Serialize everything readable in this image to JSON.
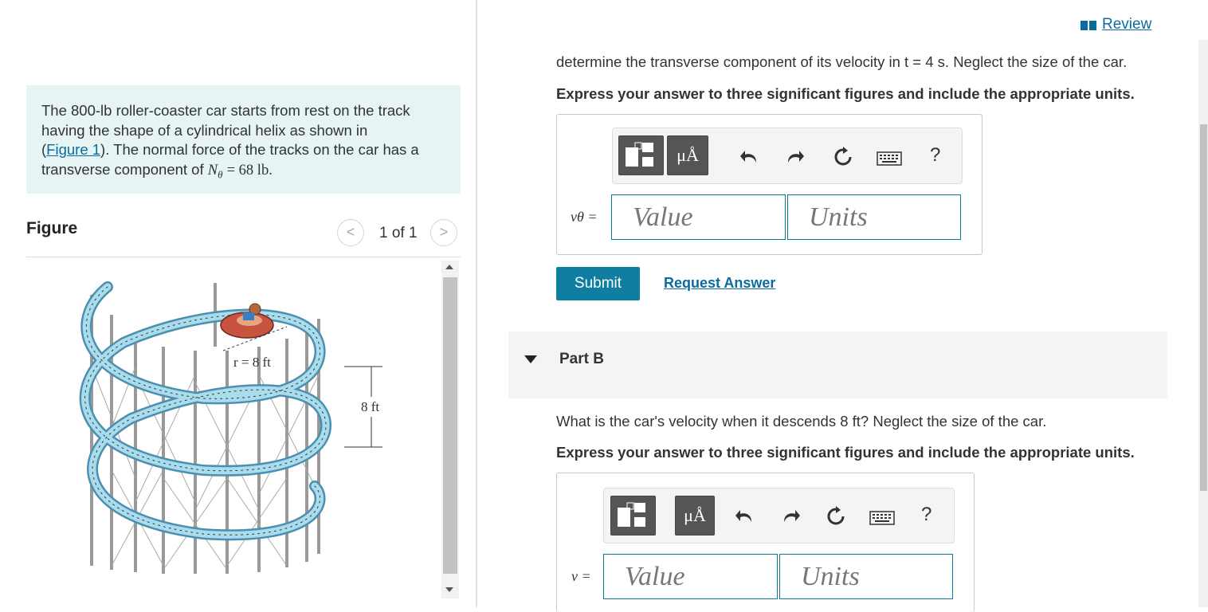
{
  "review": {
    "label": "Review"
  },
  "problem": {
    "line1": "The 800-lb roller-coaster car starts from rest on the track",
    "line2": "having the shape of a cylindrical helix as shown in",
    "line3_pre": "(",
    "figure_link": "Figure 1",
    "line3_post": "). The normal force of the tracks on the car has a",
    "line4_pre": "transverse component of",
    "line4_var": "N",
    "line4_sub": "θ",
    "line4_post": "= 68 lb."
  },
  "figure": {
    "title": "Figure",
    "pager": "1 of 1",
    "prev": "<",
    "next": ">",
    "label_r": "r = 8 ft",
    "label_h": "8 ft"
  },
  "partA": {
    "question": "determine the transverse component of its velocity in t = 4 s. Neglect the size of the car.",
    "instruction": "Express your answer to three significant figures and include the appropriate units.",
    "var_label": "vθ =",
    "value_placeholder": "Value",
    "units_placeholder": "Units",
    "submit": "Submit",
    "request": "Request Answer"
  },
  "partB": {
    "title": "Part B",
    "question": "What is the car's velocity when it descends 8 ft? Neglect the size of the car.",
    "instruction": "Express your answer to three significant figures and include the appropriate units.",
    "var_label": "v =",
    "value_placeholder": "Value",
    "units_placeholder": "Units"
  },
  "toolbar": {
    "units_button": "μÅ",
    "help": "?"
  },
  "icons": [
    "book-icon",
    "templates-icon",
    "undo-icon",
    "redo-icon",
    "reset-icon",
    "keyboard-icon",
    "help-icon",
    "caret-down-icon"
  ],
  "colors": {
    "accent": "#0f7ea1",
    "link": "#0b6b9e",
    "problem_bg": "#e6f4f4",
    "helix": "#7ec3dc"
  }
}
